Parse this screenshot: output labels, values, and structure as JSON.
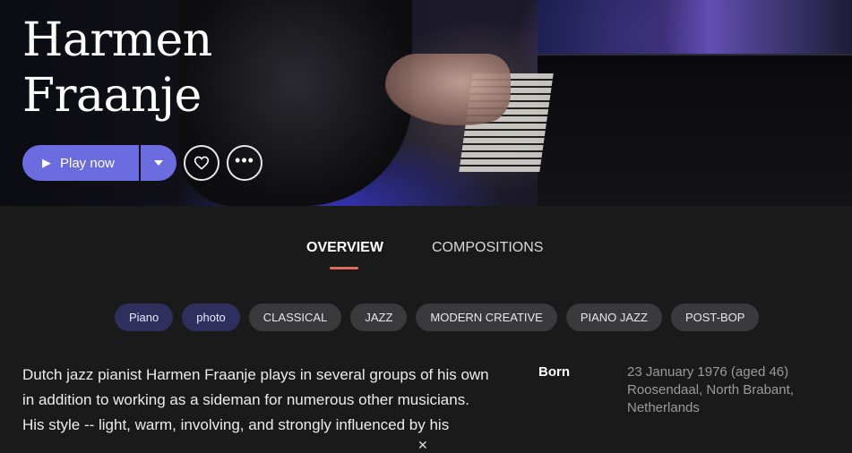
{
  "artist": {
    "name_line1": "Harmen",
    "name_line2": "Fraanje"
  },
  "actions": {
    "play_label": "Play now",
    "play_icon": "play-icon",
    "dropdown_icon": "caret-down-icon",
    "favorite_icon": "heart-icon",
    "more_icon": "ellipsis-icon",
    "accent_color": "#6b6cdf"
  },
  "tabs": [
    {
      "label": "OVERVIEW",
      "active": true
    },
    {
      "label": "COMPOSITIONS",
      "active": false
    }
  ],
  "tab_indicator_color": "#e06a5c",
  "chips": [
    {
      "label": "Piano",
      "kind": "role"
    },
    {
      "label": "photo",
      "kind": "role"
    },
    {
      "label": "CLASSICAL",
      "kind": "genre"
    },
    {
      "label": "JAZZ",
      "kind": "genre"
    },
    {
      "label": "MODERN CREATIVE",
      "kind": "genre"
    },
    {
      "label": "PIANO JAZZ",
      "kind": "genre"
    },
    {
      "label": "POST-BOP",
      "kind": "genre"
    }
  ],
  "bio": {
    "line1": "Dutch jazz pianist Harmen Fraanje plays in several groups of his own",
    "line2": "in addition to working as a sideman for numerous other musicians.",
    "line3": "His style -- light, warm, involving, and strongly influenced by his"
  },
  "facts": {
    "born_label": "Born",
    "born_date": "23 January 1976 (aged 46)",
    "born_place_line1": "Roosendaal, North Brabant,",
    "born_place_line2": "Netherlands"
  },
  "expand_icon": "close-icon"
}
